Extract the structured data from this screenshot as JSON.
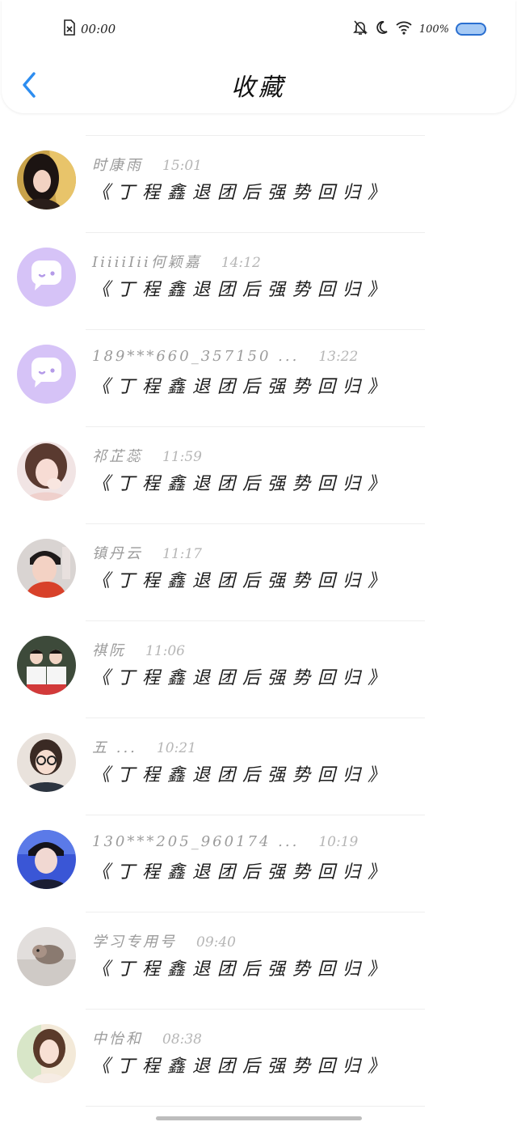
{
  "status_bar": {
    "time": "00:00",
    "battery": "100%",
    "icons": [
      "sim-missing-icon",
      "bell-off-icon",
      "moon-icon",
      "wifi-icon",
      "battery-icon"
    ]
  },
  "header": {
    "title": "收藏",
    "back_icon": "chevron-left-icon"
  },
  "favorites": [
    {
      "name": "时康雨",
      "time": "15:01",
      "title": "《丁程鑫退团后强势回归》",
      "avatar": "photo"
    },
    {
      "name": "IiiiiIii何颖嘉",
      "time": "14:12",
      "title": "《丁程鑫退团后强势回归》",
      "avatar": "default-chat-icon"
    },
    {
      "name": "189***660_357150 ...",
      "time": "13:22",
      "title": "《丁程鑫退团后强势回归》",
      "avatar": "default-chat-icon"
    },
    {
      "name": "祁芷蕊",
      "time": "11:59",
      "title": "《丁程鑫退团后强势回归》",
      "avatar": "photo"
    },
    {
      "name": "镇丹云",
      "time": "11:17",
      "title": "《丁程鑫退团后强势回归》",
      "avatar": "photo"
    },
    {
      "name": "祺阮",
      "time": "11:06",
      "title": "《丁程鑫退团后强势回归》",
      "avatar": "photo"
    },
    {
      "name": "五 ...",
      "time": "10:21",
      "title": "《丁程鑫退团后强势回归》",
      "avatar": "photo"
    },
    {
      "name": "130***205_960174 ...",
      "time": "10:19",
      "title": "《丁程鑫退团后强势回归》",
      "avatar": "photo"
    },
    {
      "name": "学习专用号",
      "time": "09:40",
      "title": "《丁程鑫退团后强势回归》",
      "avatar": "photo"
    },
    {
      "name": "中怡和",
      "time": "08:38",
      "title": "《丁程鑫退团后强势回归》",
      "avatar": "photo"
    }
  ],
  "colors": {
    "accent": "#2d8df0",
    "default_avatar": "#d6c3f7",
    "battery_fill": "#a6caf5"
  }
}
